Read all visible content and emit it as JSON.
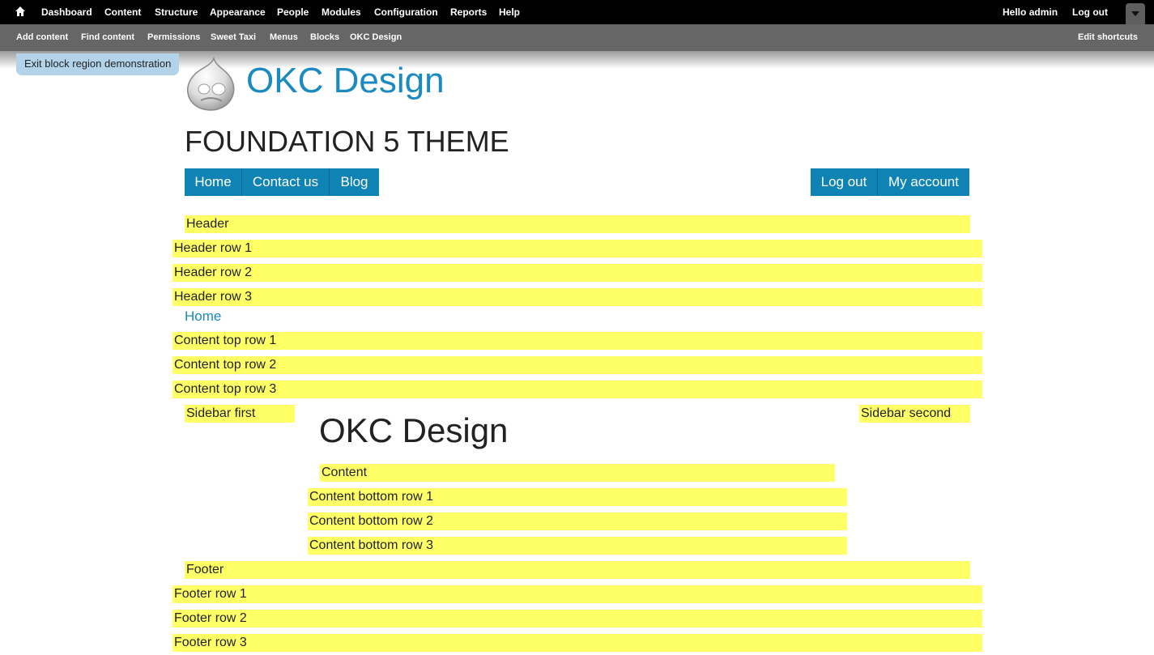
{
  "toolbar": {
    "items": [
      "Dashboard",
      "Content",
      "Structure",
      "Appearance",
      "People",
      "Modules",
      "Configuration",
      "Reports",
      "Help"
    ],
    "greeting": "Hello",
    "username": "admin",
    "logout": "Log out"
  },
  "shortcuts": {
    "items": [
      "Add content",
      "Find content",
      "Permissions",
      "Sweet Taxi",
      "Menus",
      "Blocks",
      "OKC Design"
    ],
    "edit": "Edit shortcuts"
  },
  "exit_demo": "Exit block region demonstration",
  "site": {
    "name": "OKC Design",
    "slogan": "FOUNDATION 5 THEME"
  },
  "main_menu": [
    "Home",
    "Contact us",
    "Blog"
  ],
  "user_menu": [
    "Log out",
    "My account"
  ],
  "regions": {
    "header": "Header",
    "header_rows": [
      "Header row 1",
      "Header row 2",
      "Header row 3"
    ],
    "content_top_rows": [
      "Content top row 1",
      "Content top row 2",
      "Content top row 3"
    ],
    "sidebar_first": "Sidebar first",
    "sidebar_second": "Sidebar second",
    "content": "Content",
    "content_bottom_rows": [
      "Content bottom row 1",
      "Content bottom row 2",
      "Content bottom row 3"
    ],
    "footer": "Footer",
    "footer_rows": [
      "Footer row 1",
      "Footer row 2",
      "Footer row 3"
    ]
  },
  "breadcrumb": "Home",
  "page_title": "OKC Design",
  "colors": {
    "toolbar_bg": "#000000",
    "shortcut_bg": "#666666",
    "link_blue": "#1a8ac1",
    "nav_blue": "#0f84b4",
    "region_yellow": "#ffff66"
  }
}
